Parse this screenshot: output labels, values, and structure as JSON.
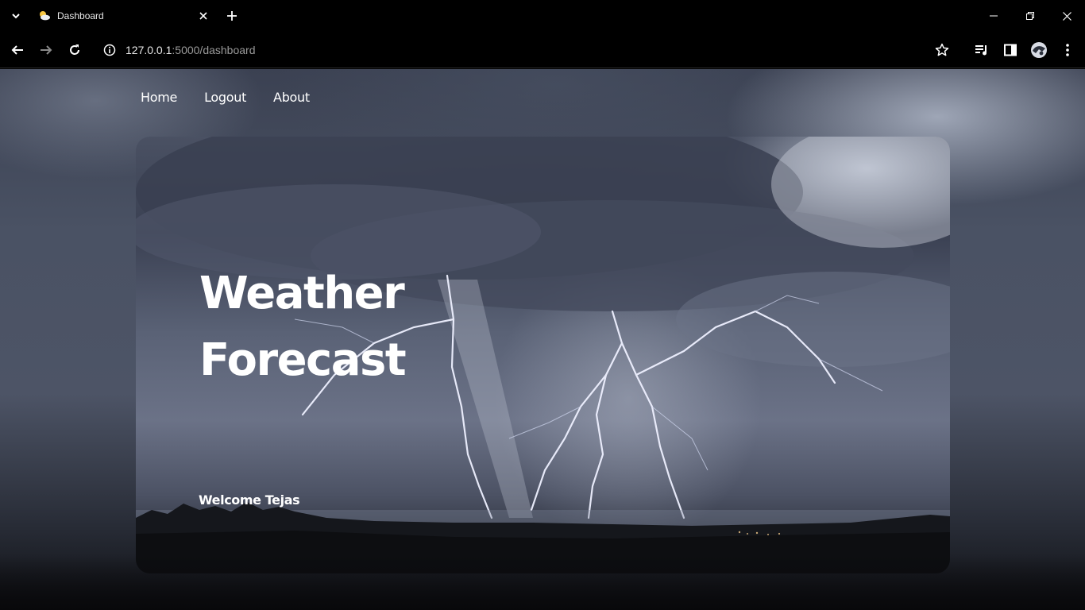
{
  "browser": {
    "tab_title": "Dashboard",
    "url_host": "127.0.0.1",
    "url_path": ":5000/dashboard"
  },
  "nav": {
    "items": [
      "Home",
      "Logout",
      "About"
    ]
  },
  "hero": {
    "title_line1": "Weather",
    "title_line2": "Forecast",
    "welcome": "Welcome Tejas"
  },
  "icons": {
    "tab_list": "chevron-down-icon",
    "favicon": "partly-cloudy-icon",
    "close": "close-icon",
    "new_tab": "plus-icon",
    "back": "arrow-left-icon",
    "forward": "arrow-right-icon",
    "reload": "reload-icon",
    "info": "info-icon",
    "bookmark": "star-icon",
    "media": "playlist-icon",
    "sidebar": "side-panel-icon",
    "profile": "avatar-icon",
    "menu": "kebab-menu-icon"
  },
  "colors": {
    "chrome_bg": "#000000",
    "text": "#ffffff",
    "url_dim": "#9a9a9a"
  }
}
